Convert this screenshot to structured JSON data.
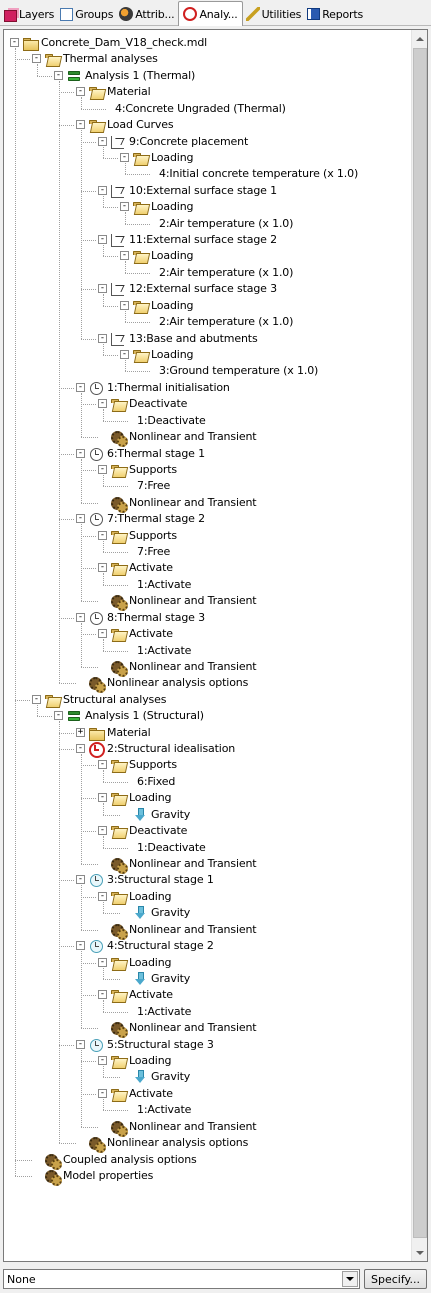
{
  "tabs": [
    {
      "label": "Layers",
      "icon": "layers-icon",
      "active": false
    },
    {
      "label": "Groups",
      "icon": "groups-icon",
      "active": false
    },
    {
      "label": "Attrib...",
      "icon": "attributes-icon",
      "active": false
    },
    {
      "label": "Analy...",
      "icon": "analysis-clock-icon",
      "active": true
    },
    {
      "label": "Utilities",
      "icon": "utilities-icon",
      "active": false
    },
    {
      "label": "Reports",
      "icon": "reports-icon",
      "active": false
    }
  ],
  "tree": [
    {
      "level": 0,
      "label": "Concrete_Dam_V18_check.mdl",
      "icon": "model-file",
      "expander": "-"
    },
    {
      "level": 1,
      "label": "Thermal analyses",
      "icon": "folder-open",
      "expander": "-"
    },
    {
      "level": 2,
      "label": "Analysis 1 (Thermal)",
      "icon": "analysis",
      "expander": "-"
    },
    {
      "level": 3,
      "label": "Material",
      "icon": "folder-open",
      "expander": "-"
    },
    {
      "level": 4,
      "label": "4:Concrete Ungraded (Thermal)",
      "icon": "",
      "expander": ""
    },
    {
      "level": 3,
      "label": "Load Curves",
      "icon": "folder-open",
      "expander": "-"
    },
    {
      "level": 4,
      "label": "9:Concrete placement",
      "icon": "curve",
      "expander": "-"
    },
    {
      "level": 5,
      "label": "Loading",
      "icon": "folder-open",
      "expander": "-"
    },
    {
      "level": 6,
      "label": "4:Initial concrete temperature (x 1.0)",
      "icon": "",
      "expander": ""
    },
    {
      "level": 4,
      "label": "10:External surface stage 1",
      "icon": "curve",
      "expander": "-"
    },
    {
      "level": 5,
      "label": "Loading",
      "icon": "folder-open",
      "expander": "-"
    },
    {
      "level": 6,
      "label": "2:Air temperature (x 1.0)",
      "icon": "",
      "expander": ""
    },
    {
      "level": 4,
      "label": "11:External surface stage 2",
      "icon": "curve",
      "expander": "-"
    },
    {
      "level": 5,
      "label": "Loading",
      "icon": "folder-open",
      "expander": "-"
    },
    {
      "level": 6,
      "label": "2:Air temperature (x 1.0)",
      "icon": "",
      "expander": ""
    },
    {
      "level": 4,
      "label": "12:External surface stage 3",
      "icon": "curve",
      "expander": "-"
    },
    {
      "level": 5,
      "label": "Loading",
      "icon": "folder-open",
      "expander": "-"
    },
    {
      "level": 6,
      "label": "2:Air temperature (x 1.0)",
      "icon": "",
      "expander": ""
    },
    {
      "level": 4,
      "label": "13:Base and abutments",
      "icon": "curve",
      "expander": "-"
    },
    {
      "level": 5,
      "label": "Loading",
      "icon": "folder-open",
      "expander": "-"
    },
    {
      "level": 6,
      "label": "3:Ground temperature (x 1.0)",
      "icon": "",
      "expander": ""
    },
    {
      "level": 3,
      "label": "1:Thermal initialisation",
      "icon": "clock",
      "expander": "-"
    },
    {
      "level": 4,
      "label": "Deactivate",
      "icon": "folder-open",
      "expander": "-"
    },
    {
      "level": 5,
      "label": "1:Deactivate",
      "icon": "",
      "expander": ""
    },
    {
      "level": 4,
      "label": "Nonlinear and Transient",
      "icon": "gears",
      "expander": ""
    },
    {
      "level": 3,
      "label": "6:Thermal stage 1",
      "icon": "clock",
      "expander": "-"
    },
    {
      "level": 4,
      "label": "Supports",
      "icon": "folder-open",
      "expander": "-"
    },
    {
      "level": 5,
      "label": "7:Free",
      "icon": "",
      "expander": ""
    },
    {
      "level": 4,
      "label": "Nonlinear and Transient",
      "icon": "gears",
      "expander": ""
    },
    {
      "level": 3,
      "label": "7:Thermal stage 2",
      "icon": "clock",
      "expander": "-"
    },
    {
      "level": 4,
      "label": "Supports",
      "icon": "folder-open",
      "expander": "-"
    },
    {
      "level": 5,
      "label": "7:Free",
      "icon": "",
      "expander": ""
    },
    {
      "level": 4,
      "label": "Activate",
      "icon": "folder-open",
      "expander": "-"
    },
    {
      "level": 5,
      "label": "1:Activate",
      "icon": "",
      "expander": ""
    },
    {
      "level": 4,
      "label": "Nonlinear and Transient",
      "icon": "gears",
      "expander": ""
    },
    {
      "level": 3,
      "label": "8:Thermal stage 3",
      "icon": "clock",
      "expander": "-"
    },
    {
      "level": 4,
      "label": "Activate",
      "icon": "folder-open",
      "expander": "-"
    },
    {
      "level": 5,
      "label": "1:Activate",
      "icon": "",
      "expander": ""
    },
    {
      "level": 4,
      "label": "Nonlinear and Transient",
      "icon": "gears",
      "expander": ""
    },
    {
      "level": 3,
      "label": "Nonlinear analysis options",
      "icon": "gears",
      "expander": ""
    },
    {
      "level": 1,
      "label": "Structural analyses",
      "icon": "folder-open",
      "expander": "-"
    },
    {
      "level": 2,
      "label": "Analysis 1 (Structural)",
      "icon": "analysis",
      "expander": "-"
    },
    {
      "level": 3,
      "label": "Material",
      "icon": "folder",
      "expander": "+"
    },
    {
      "level": 3,
      "label": "2:Structural idealisation",
      "icon": "ideal",
      "expander": "-"
    },
    {
      "level": 4,
      "label": "Supports",
      "icon": "folder-open",
      "expander": "-"
    },
    {
      "level": 5,
      "label": "6:Fixed",
      "icon": "",
      "expander": ""
    },
    {
      "level": 4,
      "label": "Loading",
      "icon": "folder-open",
      "expander": "-"
    },
    {
      "level": 5,
      "label": "Gravity",
      "icon": "gravity",
      "expander": ""
    },
    {
      "level": 4,
      "label": "Deactivate",
      "icon": "folder-open",
      "expander": "-"
    },
    {
      "level": 5,
      "label": "1:Deactivate",
      "icon": "",
      "expander": ""
    },
    {
      "level": 4,
      "label": "Nonlinear and Transient",
      "icon": "gears",
      "expander": ""
    },
    {
      "level": 3,
      "label": "3:Structural stage 1",
      "icon": "clock-struct",
      "expander": "-"
    },
    {
      "level": 4,
      "label": "Loading",
      "icon": "folder-open",
      "expander": "-"
    },
    {
      "level": 5,
      "label": "Gravity",
      "icon": "gravity",
      "expander": ""
    },
    {
      "level": 4,
      "label": "Nonlinear and Transient",
      "icon": "gears",
      "expander": ""
    },
    {
      "level": 3,
      "label": "4:Structural stage 2",
      "icon": "clock-struct",
      "expander": "-"
    },
    {
      "level": 4,
      "label": "Loading",
      "icon": "folder-open",
      "expander": "-"
    },
    {
      "level": 5,
      "label": "Gravity",
      "icon": "gravity",
      "expander": ""
    },
    {
      "level": 4,
      "label": "Activate",
      "icon": "folder-open",
      "expander": "-"
    },
    {
      "level": 5,
      "label": "1:Activate",
      "icon": "",
      "expander": ""
    },
    {
      "level": 4,
      "label": "Nonlinear and Transient",
      "icon": "gears",
      "expander": ""
    },
    {
      "level": 3,
      "label": "5:Structural stage 3",
      "icon": "clock-struct",
      "expander": "-"
    },
    {
      "level": 4,
      "label": "Loading",
      "icon": "folder-open",
      "expander": "-"
    },
    {
      "level": 5,
      "label": "Gravity",
      "icon": "gravity",
      "expander": ""
    },
    {
      "level": 4,
      "label": "Activate",
      "icon": "folder-open",
      "expander": "-"
    },
    {
      "level": 5,
      "label": "1:Activate",
      "icon": "",
      "expander": ""
    },
    {
      "level": 4,
      "label": "Nonlinear and Transient",
      "icon": "gears",
      "expander": ""
    },
    {
      "level": 3,
      "label": "Nonlinear analysis options",
      "icon": "gears",
      "expander": ""
    },
    {
      "level": 1,
      "label": "Coupled analysis options",
      "icon": "gears",
      "expander": ""
    },
    {
      "level": 1,
      "label": "Model properties",
      "icon": "gears",
      "expander": ""
    }
  ],
  "bottom": {
    "selector_value": "None",
    "specify_label": "Specify..."
  }
}
